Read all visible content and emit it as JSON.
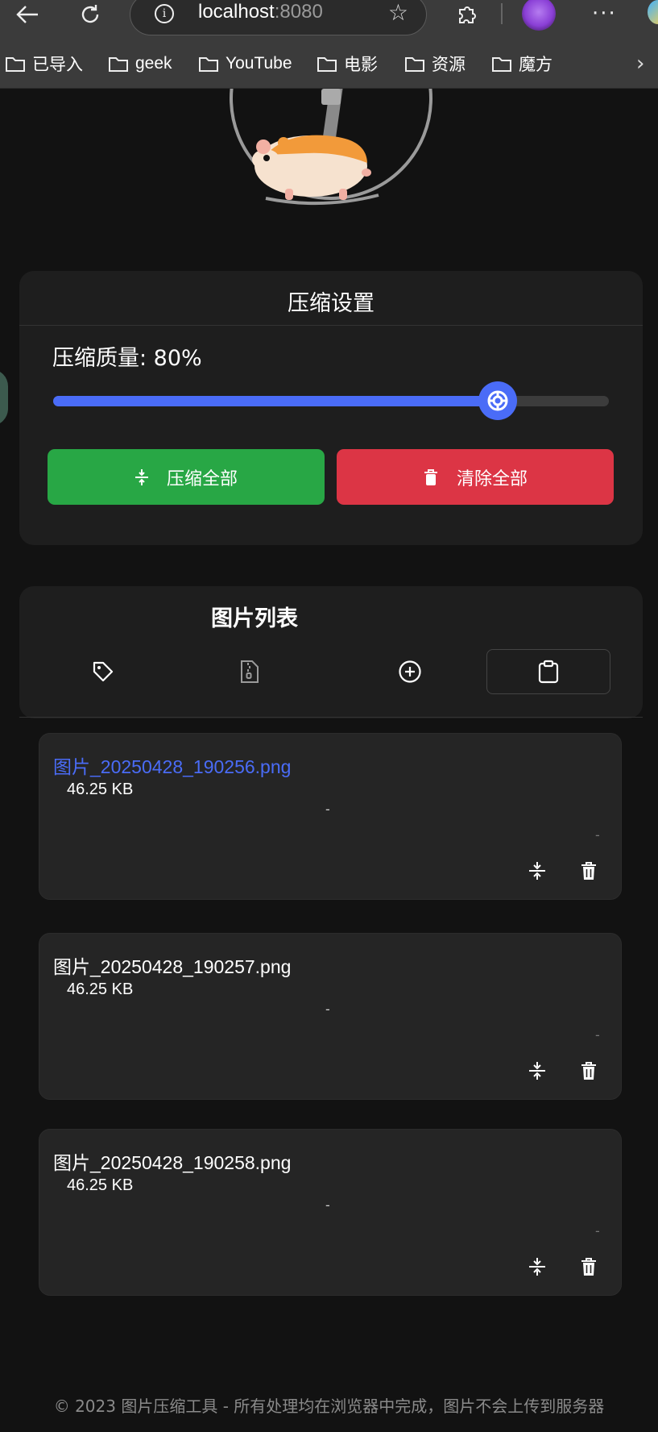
{
  "browser": {
    "url_host": "localhost",
    "url_port": ":8080",
    "bookmarks": [
      {
        "label": "已导入"
      },
      {
        "label": "geek"
      },
      {
        "label": "YouTube"
      },
      {
        "label": "电影"
      },
      {
        "label": "资源"
      },
      {
        "label": "魔方"
      }
    ]
  },
  "settings": {
    "title": "压缩设置",
    "quality_label": "压缩质量: 80%",
    "quality_value": 80,
    "compress_all_label": "压缩全部",
    "clear_all_label": "清除全部",
    "accent_blue": "#4a6cf7",
    "green": "#28a745",
    "red": "#dc3545"
  },
  "list": {
    "title": "图片列表",
    "tools": [
      "tag-icon",
      "zip-file-icon",
      "add-circle-icon",
      "clipboard-icon"
    ],
    "items": [
      {
        "name": "图片_20250428_190256.png",
        "size": "46.25 KB",
        "dash_a": "-",
        "dash_b": "-"
      },
      {
        "name": "图片_20250428_190257.png",
        "size": "46.25 KB",
        "dash_a": "-",
        "dash_b": "-"
      },
      {
        "name": "图片_20250428_190258.png",
        "size": "46.25 KB",
        "dash_a": "-",
        "dash_b": "-"
      }
    ]
  },
  "footer": {
    "text": "© 2023 图片压缩工具 - 所有处理均在浏览器中完成，图片不会上传到服务器"
  }
}
